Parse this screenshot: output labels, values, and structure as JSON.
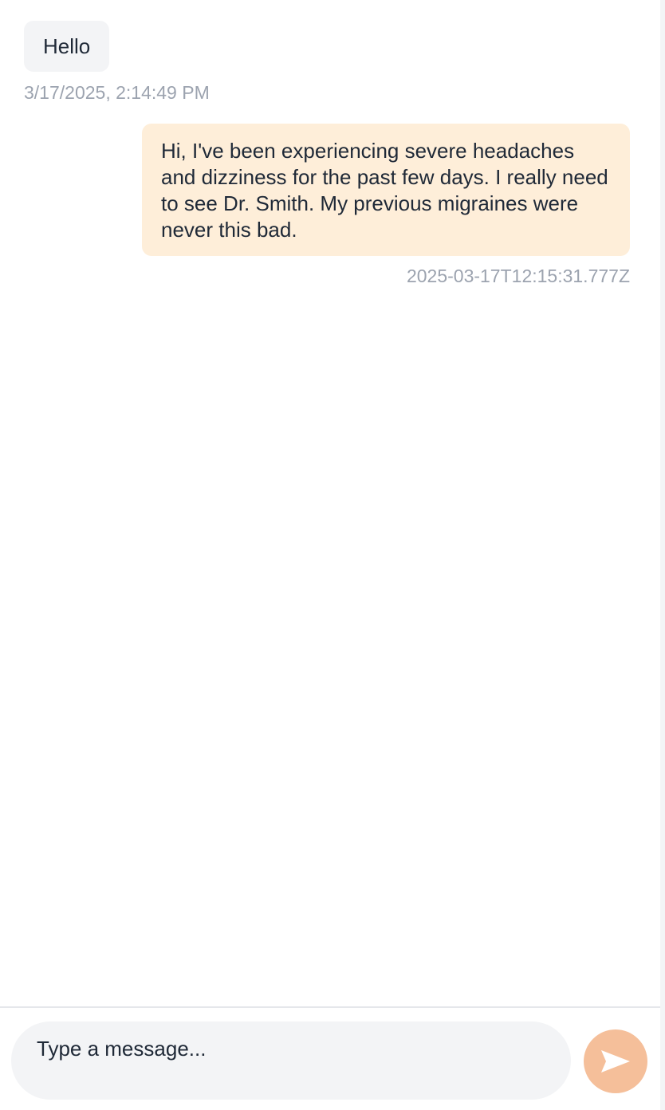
{
  "messages": [
    {
      "direction": "incoming",
      "text": "Hello",
      "timestamp": "3/17/2025, 2:14:49 PM"
    },
    {
      "direction": "outgoing",
      "text": "Hi, I've been experiencing severe headaches and dizziness for the past few days. I really need to see Dr. Smith. My previous migraines were never this bad.",
      "timestamp": "2025-03-17T12:15:31.777Z"
    }
  ],
  "composer": {
    "placeholder": "Type a message...",
    "send_icon": "send-icon"
  },
  "colors": {
    "incoming_bubble": "#f3f4f6",
    "outgoing_bubble": "#feeed9",
    "timestamp_text": "#9ca3af",
    "send_button": "#f5bf9a",
    "input_background": "#f3f4f6"
  }
}
